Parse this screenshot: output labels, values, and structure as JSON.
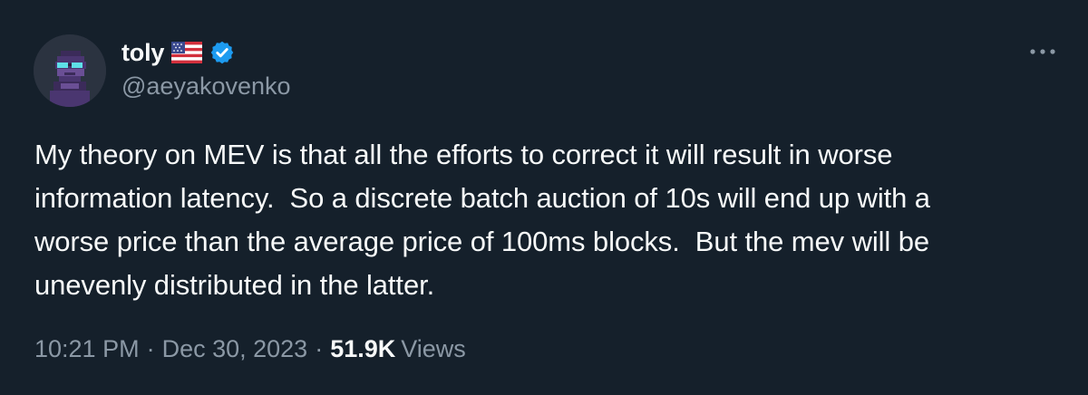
{
  "author": {
    "display_name": "toly",
    "handle": "@aeyakovenko",
    "flag_icon": "us-flag-icon",
    "verified_icon": "verified-badge-icon",
    "verified_color": "#1d9bf0"
  },
  "more_icon": "more-horizontal-icon",
  "tweet": {
    "text": "My theory on MEV is that all the efforts to correct it will result in worse\ninformation latency.  So a discrete batch auction of 10s will end up with a\nworse price than the average price of 100ms blocks.  But the mev will be\nunevenly distributed in the latter."
  },
  "meta": {
    "time": "10:21 PM",
    "separator": "·",
    "date": "Dec 30, 2023",
    "views_count": "51.9K",
    "views_label": "Views"
  },
  "colors": {
    "background": "#15202b",
    "text_primary": "#f7f9f9",
    "text_secondary": "#8b98a5"
  }
}
